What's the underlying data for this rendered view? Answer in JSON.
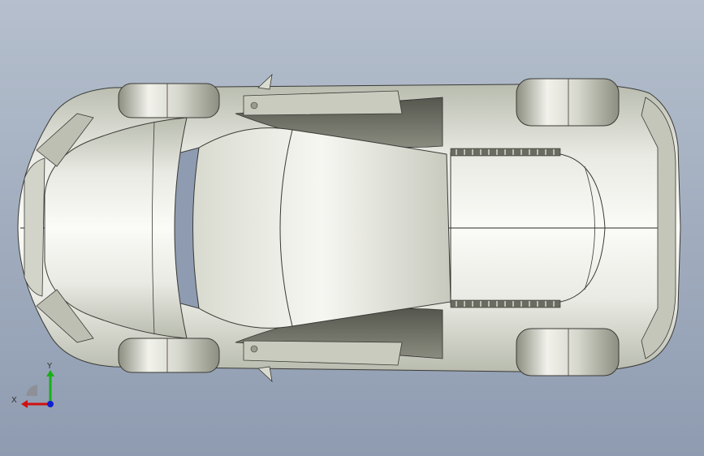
{
  "viewport": {
    "background_top": "#b5bfcd",
    "background_bottom": "#8f9bb0",
    "model": "car-top-view"
  },
  "triad": {
    "x_label": "X",
    "y_label": "Y",
    "x_color": "#d01010",
    "y_color": "#18b018",
    "z_color": "#1020d0"
  }
}
